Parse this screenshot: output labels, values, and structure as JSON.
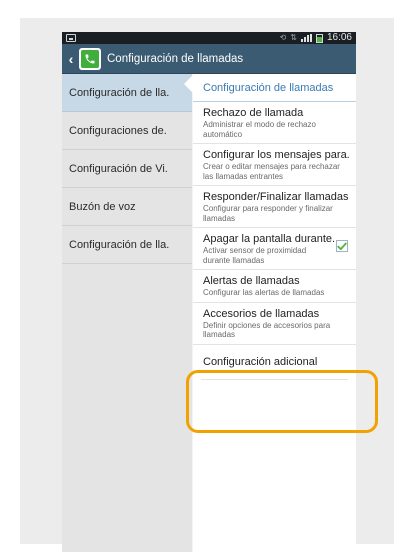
{
  "status_bar": {
    "time": "16:06",
    "accent": "#57b33e"
  },
  "title_bar": {
    "title": "Configuración de llamadas",
    "background": "#3a5b72"
  },
  "sidebar": {
    "items": [
      {
        "label": "Configuración de lla.",
        "active": true
      },
      {
        "label": "Configuraciones de."
      },
      {
        "label": "Configuración de Vi."
      },
      {
        "label": "Buzón de voz"
      },
      {
        "label": "Configuración de lla."
      }
    ]
  },
  "main": {
    "section_title": "Configuración de llamadas",
    "items": [
      {
        "title": "Rechazo de llamada",
        "subtitle": "Administrar el modo de rechazo automático"
      },
      {
        "title": "Configurar los mensajes para.",
        "subtitle": "Crear o editar mensajes para rechazar las llamadas entrantes"
      },
      {
        "title": "Responder/Finalizar llamadas",
        "subtitle": "Configurar para responder y finalizar llamadas"
      },
      {
        "title": "Apagar la pantalla durante.",
        "subtitle": "Activar sensor de proximidad durante llamadas",
        "checked": true
      },
      {
        "title": "Alertas de llamadas",
        "subtitle": "Configurar las alertas de llamadas"
      },
      {
        "title": "Accesorios de llamadas",
        "subtitle": "Definir opciones de accesorios para llamadas"
      },
      {
        "title": "Configuración adicional"
      }
    ]
  },
  "highlight_color": "#f1a100"
}
